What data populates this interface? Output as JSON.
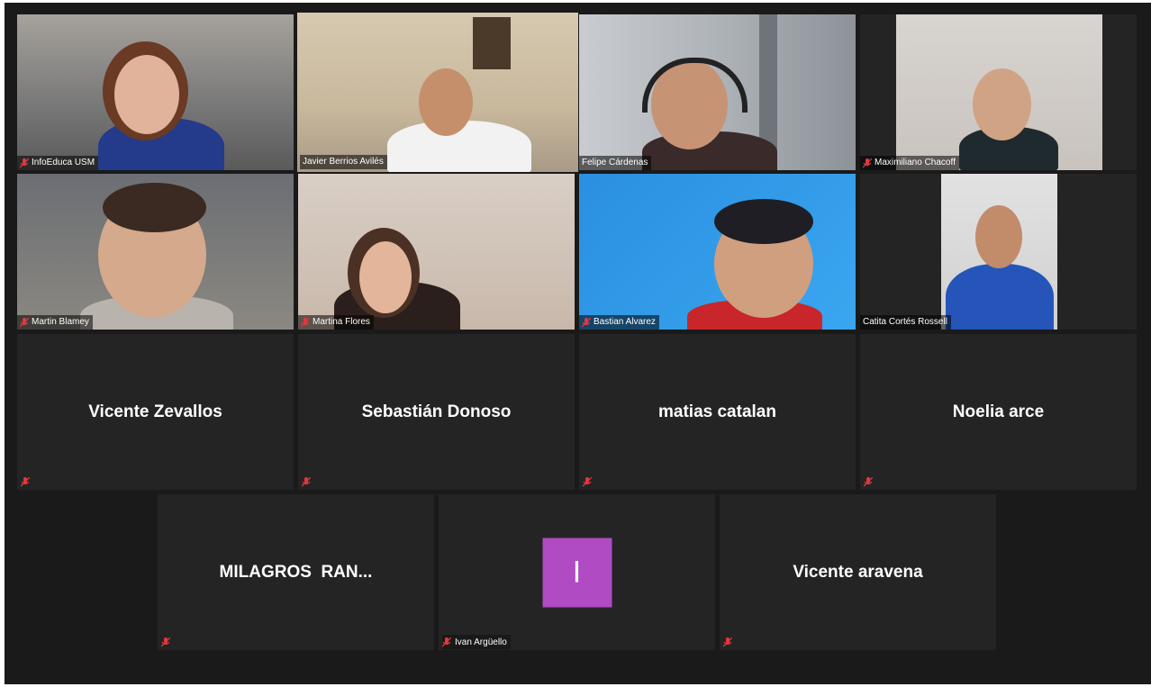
{
  "colors": {
    "active_speaker_border": "#e4e67a",
    "tile_bg": "#242424",
    "avatar_bg": "#b04bc4",
    "mute_icon": "#e0393e"
  },
  "participants_video": [
    {
      "name": "InfoEduca USM",
      "muted": true
    },
    {
      "name": "Javier Berrios Avilés",
      "muted": false,
      "active_speaker": true
    },
    {
      "name": "Felipe Cárdenas",
      "muted": false
    },
    {
      "name": "Maximiliano Chacoff",
      "muted": true
    },
    {
      "name": "Martin Blamey",
      "muted": true
    },
    {
      "name": "Martina Flores",
      "muted": true
    },
    {
      "name": "Bastian Alvarez",
      "muted": true
    },
    {
      "name": "Catita Cortés Rossell",
      "muted": false
    }
  ],
  "participants_no_video": [
    {
      "name": "Vicente Zevallos",
      "muted": true
    },
    {
      "name": "Sebastián Donoso",
      "muted": true
    },
    {
      "name": "matias catalan",
      "muted": true
    },
    {
      "name": "Noelia arce",
      "muted": true
    },
    {
      "name": "MILAGROS  RAN...",
      "muted": true
    },
    {
      "name": "Ivan Argüello",
      "avatar_letter": "I",
      "muted": true
    },
    {
      "name": "Vicente aravena",
      "muted": true
    }
  ]
}
